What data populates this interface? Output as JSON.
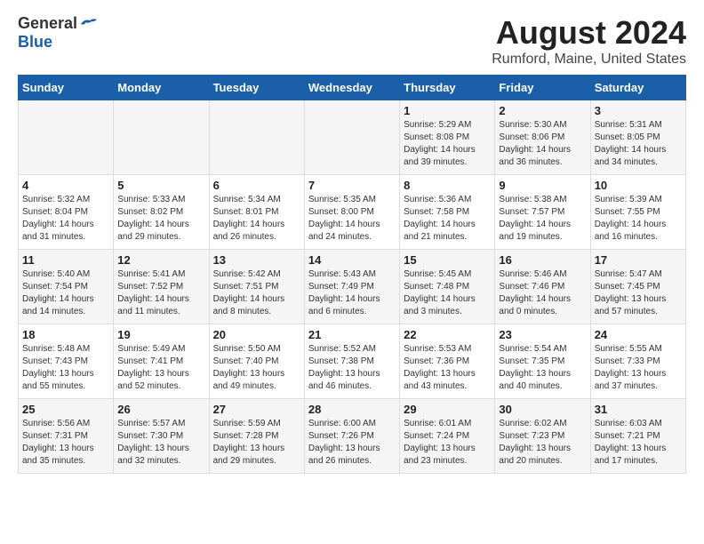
{
  "header": {
    "logo_general": "General",
    "logo_blue": "Blue",
    "month": "August 2024",
    "location": "Rumford, Maine, United States"
  },
  "days_of_week": [
    "Sunday",
    "Monday",
    "Tuesday",
    "Wednesday",
    "Thursday",
    "Friday",
    "Saturday"
  ],
  "weeks": [
    [
      {
        "day": "",
        "content": ""
      },
      {
        "day": "",
        "content": ""
      },
      {
        "day": "",
        "content": ""
      },
      {
        "day": "",
        "content": ""
      },
      {
        "day": "1",
        "content": "Sunrise: 5:29 AM\nSunset: 8:08 PM\nDaylight: 14 hours\nand 39 minutes."
      },
      {
        "day": "2",
        "content": "Sunrise: 5:30 AM\nSunset: 8:06 PM\nDaylight: 14 hours\nand 36 minutes."
      },
      {
        "day": "3",
        "content": "Sunrise: 5:31 AM\nSunset: 8:05 PM\nDaylight: 14 hours\nand 34 minutes."
      }
    ],
    [
      {
        "day": "4",
        "content": "Sunrise: 5:32 AM\nSunset: 8:04 PM\nDaylight: 14 hours\nand 31 minutes."
      },
      {
        "day": "5",
        "content": "Sunrise: 5:33 AM\nSunset: 8:02 PM\nDaylight: 14 hours\nand 29 minutes."
      },
      {
        "day": "6",
        "content": "Sunrise: 5:34 AM\nSunset: 8:01 PM\nDaylight: 14 hours\nand 26 minutes."
      },
      {
        "day": "7",
        "content": "Sunrise: 5:35 AM\nSunset: 8:00 PM\nDaylight: 14 hours\nand 24 minutes."
      },
      {
        "day": "8",
        "content": "Sunrise: 5:36 AM\nSunset: 7:58 PM\nDaylight: 14 hours\nand 21 minutes."
      },
      {
        "day": "9",
        "content": "Sunrise: 5:38 AM\nSunset: 7:57 PM\nDaylight: 14 hours\nand 19 minutes."
      },
      {
        "day": "10",
        "content": "Sunrise: 5:39 AM\nSunset: 7:55 PM\nDaylight: 14 hours\nand 16 minutes."
      }
    ],
    [
      {
        "day": "11",
        "content": "Sunrise: 5:40 AM\nSunset: 7:54 PM\nDaylight: 14 hours\nand 14 minutes."
      },
      {
        "day": "12",
        "content": "Sunrise: 5:41 AM\nSunset: 7:52 PM\nDaylight: 14 hours\nand 11 minutes."
      },
      {
        "day": "13",
        "content": "Sunrise: 5:42 AM\nSunset: 7:51 PM\nDaylight: 14 hours\nand 8 minutes."
      },
      {
        "day": "14",
        "content": "Sunrise: 5:43 AM\nSunset: 7:49 PM\nDaylight: 14 hours\nand 6 minutes."
      },
      {
        "day": "15",
        "content": "Sunrise: 5:45 AM\nSunset: 7:48 PM\nDaylight: 14 hours\nand 3 minutes."
      },
      {
        "day": "16",
        "content": "Sunrise: 5:46 AM\nSunset: 7:46 PM\nDaylight: 14 hours\nand 0 minutes."
      },
      {
        "day": "17",
        "content": "Sunrise: 5:47 AM\nSunset: 7:45 PM\nDaylight: 13 hours\nand 57 minutes."
      }
    ],
    [
      {
        "day": "18",
        "content": "Sunrise: 5:48 AM\nSunset: 7:43 PM\nDaylight: 13 hours\nand 55 minutes."
      },
      {
        "day": "19",
        "content": "Sunrise: 5:49 AM\nSunset: 7:41 PM\nDaylight: 13 hours\nand 52 minutes."
      },
      {
        "day": "20",
        "content": "Sunrise: 5:50 AM\nSunset: 7:40 PM\nDaylight: 13 hours\nand 49 minutes."
      },
      {
        "day": "21",
        "content": "Sunrise: 5:52 AM\nSunset: 7:38 PM\nDaylight: 13 hours\nand 46 minutes."
      },
      {
        "day": "22",
        "content": "Sunrise: 5:53 AM\nSunset: 7:36 PM\nDaylight: 13 hours\nand 43 minutes."
      },
      {
        "day": "23",
        "content": "Sunrise: 5:54 AM\nSunset: 7:35 PM\nDaylight: 13 hours\nand 40 minutes."
      },
      {
        "day": "24",
        "content": "Sunrise: 5:55 AM\nSunset: 7:33 PM\nDaylight: 13 hours\nand 37 minutes."
      }
    ],
    [
      {
        "day": "25",
        "content": "Sunrise: 5:56 AM\nSunset: 7:31 PM\nDaylight: 13 hours\nand 35 minutes."
      },
      {
        "day": "26",
        "content": "Sunrise: 5:57 AM\nSunset: 7:30 PM\nDaylight: 13 hours\nand 32 minutes."
      },
      {
        "day": "27",
        "content": "Sunrise: 5:59 AM\nSunset: 7:28 PM\nDaylight: 13 hours\nand 29 minutes."
      },
      {
        "day": "28",
        "content": "Sunrise: 6:00 AM\nSunset: 7:26 PM\nDaylight: 13 hours\nand 26 minutes."
      },
      {
        "day": "29",
        "content": "Sunrise: 6:01 AM\nSunset: 7:24 PM\nDaylight: 13 hours\nand 23 minutes."
      },
      {
        "day": "30",
        "content": "Sunrise: 6:02 AM\nSunset: 7:23 PM\nDaylight: 13 hours\nand 20 minutes."
      },
      {
        "day": "31",
        "content": "Sunrise: 6:03 AM\nSunset: 7:21 PM\nDaylight: 13 hours\nand 17 minutes."
      }
    ]
  ]
}
